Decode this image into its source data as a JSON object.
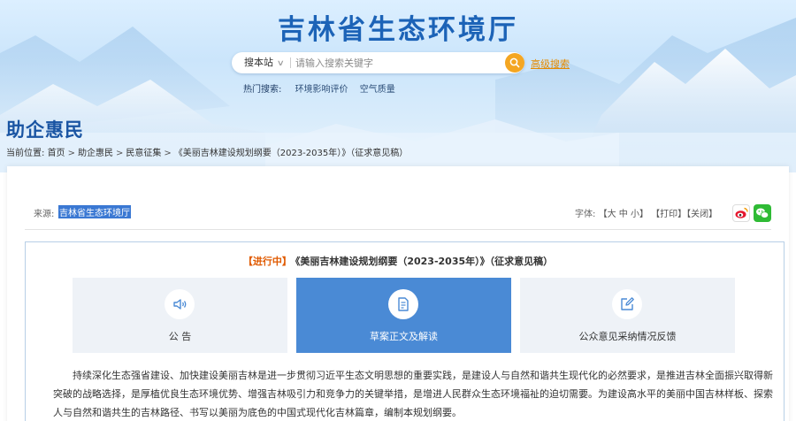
{
  "header": {
    "site_title": "吉林省生态环境厅",
    "search": {
      "scope_label": "搜本站",
      "placeholder": "请输入搜索关键字",
      "advanced_label": "高级搜索"
    },
    "hot_search": {
      "label": "热门搜索:",
      "items": [
        "环境影响评价",
        "空气质量"
      ]
    }
  },
  "section_title": "助企惠民",
  "breadcrumb": {
    "prefix": "当前位置:",
    "items": [
      "首页",
      "助企惠民",
      "民意征集",
      "《美丽吉林建设规划纲要（2023-2035年）》（征求意见稿）"
    ],
    "separator": ">"
  },
  "meta": {
    "source_label": "来源:",
    "source_value": "吉林省生态环境厅",
    "font_label": "字体:",
    "font_bracket_open": "【",
    "font_large": "大",
    "font_medium": "中",
    "font_small": "小",
    "font_bracket_close": "】",
    "print": "【打印】",
    "close": "【关闭】"
  },
  "notice": {
    "status": "【进行中】",
    "title": "《美丽吉林建设规划纲要（2023-2035年）》（征求意见稿）",
    "tiles": [
      {
        "label": "公 告",
        "icon": "speaker-icon",
        "active": false
      },
      {
        "label": "草案正文及解读",
        "icon": "document-icon",
        "active": true
      },
      {
        "label": "公众意见采纳情况反馈",
        "icon": "edit-icon",
        "active": false
      }
    ],
    "body": "持续深化生态强省建设、加快建设美丽吉林是进一步贯彻习近平生态文明思想的重要实践，是建设人与自然和谐共生现代化的必然要求，是推进吉林全面振兴取得新突破的战略选择，是厚植优良生态环境优势、增强吉林吸引力和竞争力的关键举措，是增进人民群众生态环境福祉的迫切需要。为建设高水平的美丽中国吉林样板、探索人与自然和谐共生的吉林路径、书写以美丽为底色的中国式现代化吉林篇章，编制本规划纲要。"
  },
  "colors": {
    "brand_blue": "#1c63b7",
    "active_tile": "#4a8ad5",
    "status_orange": "#e05a00",
    "search_button": "#f4a622",
    "wechat_green": "#2fbb35"
  }
}
